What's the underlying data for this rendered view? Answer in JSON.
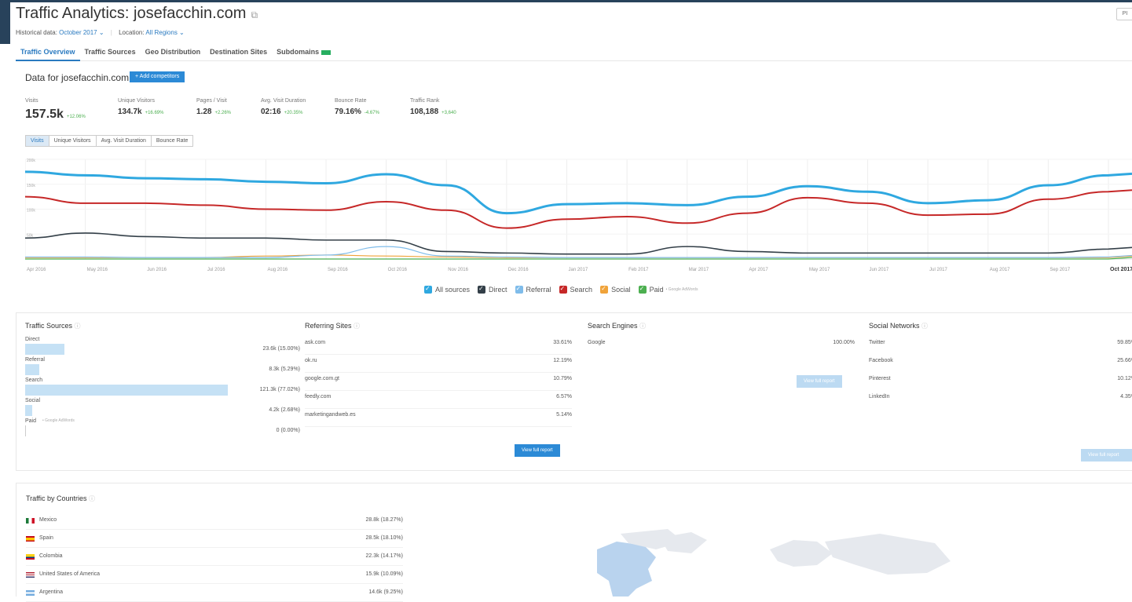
{
  "header": {
    "title": "Traffic Analytics: josefacchin.com",
    "historical_label": "Historical data:",
    "historical_value": "October 2017 ⌄",
    "location_label": "Location:",
    "location_value": "All Regions ⌄",
    "pdf_label": "PI"
  },
  "tabs": [
    {
      "label": "Traffic Overview",
      "active": true
    },
    {
      "label": "Traffic Sources"
    },
    {
      "label": "Geo Distribution"
    },
    {
      "label": "Destination Sites"
    },
    {
      "label": "Subdomains",
      "badge": true
    }
  ],
  "data_for": "Data for josefacchin.com",
  "add_competitors": "+ Add competitors",
  "kpis": [
    {
      "label": "Visits",
      "value": "157.5k",
      "change": "+12.06%"
    },
    {
      "label": "Unique Visitors",
      "value": "134.7k",
      "change": "+16.69%"
    },
    {
      "label": "Pages / Visit",
      "value": "1.28",
      "change": "+2.26%"
    },
    {
      "label": "Avg. Visit Duration",
      "value": "02:16",
      "change": "+20.35%"
    },
    {
      "label": "Bounce Rate",
      "value": "79.16%",
      "change": "-4.67%"
    },
    {
      "label": "Traffic Rank",
      "value": "108,188",
      "change": "+3,640"
    }
  ],
  "metric_tabs": [
    "Visits",
    "Unique Visitors",
    "Avg. Visit Duration",
    "Bounce Rate"
  ],
  "chart_data": {
    "type": "line",
    "x": [
      "Apr 2016",
      "May 2016",
      "Jun 2016",
      "Jul 2016",
      "Aug 2016",
      "Sep 2016",
      "Oct 2016",
      "Nov 2016",
      "Dec 2016",
      "Jan 2017",
      "Feb 2017",
      "Mar 2017",
      "Apr 2017",
      "May 2017",
      "Jun 2017",
      "Jul 2017",
      "Aug 2017",
      "Sep 2017",
      "Oct 2017"
    ],
    "y_ticks": [
      "200k",
      "150k",
      "100k",
      "50k"
    ],
    "ylim": [
      0,
      200
    ],
    "series": [
      {
        "name": "All sources",
        "color": "#2fa8e0",
        "values": [
          175,
          168,
          162,
          160,
          155,
          152,
          170,
          148,
          92,
          110,
          112,
          108,
          125,
          146,
          135,
          112,
          118,
          148,
          168
        ]
      },
      {
        "name": "Search",
        "color": "#c62828",
        "values": [
          125,
          112,
          112,
          108,
          100,
          98,
          115,
          98,
          62,
          80,
          85,
          72,
          92,
          123,
          112,
          88,
          90,
          120,
          135
        ]
      },
      {
        "name": "Direct",
        "color": "#333f48",
        "values": [
          42,
          52,
          45,
          42,
          42,
          38,
          38,
          15,
          12,
          10,
          10,
          25,
          15,
          12,
          12,
          12,
          12,
          12,
          20
        ]
      },
      {
        "name": "Referral",
        "color": "#7fbcea",
        "values": [
          4,
          4,
          3,
          3,
          3,
          8,
          25,
          6,
          4,
          3,
          3,
          3,
          3,
          3,
          3,
          3,
          3,
          3,
          4
        ]
      },
      {
        "name": "Social",
        "color": "#f0a33a",
        "values": [
          3,
          3,
          3,
          3,
          6,
          8,
          6,
          4,
          3,
          3,
          3,
          3,
          3,
          3,
          3,
          3,
          3,
          3,
          3
        ]
      },
      {
        "name": "Paid",
        "color": "#4caf50",
        "values": [
          0,
          0,
          0,
          0,
          0,
          0,
          0,
          0,
          0,
          0,
          0,
          0,
          0,
          0,
          0,
          0,
          0,
          0,
          0
        ]
      }
    ]
  },
  "legend": {
    "all": "All sources",
    "direct": "Direct",
    "referral": "Referral",
    "search": "Search",
    "social": "Social",
    "paid": "Paid",
    "paid_note": "• Google AdWords"
  },
  "traffic_sources": {
    "title": "Traffic Sources",
    "rows": [
      {
        "name": "Direct",
        "value": "23.6k (15.00%)",
        "pct": 15.0
      },
      {
        "name": "Referral",
        "value": "8.3k (5.29%)",
        "pct": 5.29
      },
      {
        "name": "Search",
        "value": "121.3k (77.02%)",
        "pct": 77.02
      },
      {
        "name": "Social",
        "value": "4.2k (2.68%)",
        "pct": 2.68
      },
      {
        "name": "Paid",
        "note": "• Google AdWords",
        "value": "0 (0.00%)",
        "pct": 0
      }
    ]
  },
  "referring_sites": {
    "title": "Referring Sites",
    "rows": [
      {
        "name": "ask.com",
        "value": "33.61%"
      },
      {
        "name": "ok.ru",
        "value": "12.19%"
      },
      {
        "name": "google.com.gt",
        "value": "10.79%"
      },
      {
        "name": "feedly.com",
        "value": "6.57%"
      },
      {
        "name": "marketingandweb.es",
        "value": "5.14%"
      }
    ],
    "button": "View full report"
  },
  "search_engines": {
    "title": "Search Engines",
    "rows": [
      {
        "name": "Google",
        "value": "100.00%"
      }
    ],
    "button": "View full report"
  },
  "social_networks": {
    "title": "Social Networks",
    "rows": [
      {
        "name": "Twitter",
        "value": "59.85%"
      },
      {
        "name": "Facebook",
        "value": "25.66%"
      },
      {
        "name": "Pinterest",
        "value": "10.12%"
      },
      {
        "name": "LinkedIn",
        "value": "4.35%"
      }
    ],
    "button": "View full report"
  },
  "countries": {
    "title": "Traffic by Countries",
    "rows": [
      {
        "name": "Mexico",
        "value": "28.8k (18.27%)",
        "flag": "mexico-flag-icon"
      },
      {
        "name": "Spain",
        "value": "28.5k (18.10%)",
        "flag": "spain-flag-icon"
      },
      {
        "name": "Colombia",
        "value": "22.3k (14.17%)",
        "flag": "colombia-flag-icon"
      },
      {
        "name": "United States of America",
        "value": "15.9k (10.09%)",
        "flag": "usa-flag-icon"
      },
      {
        "name": "Argentina",
        "value": "14.6k (9.25%)",
        "flag": "argentina-flag-icon"
      }
    ]
  }
}
